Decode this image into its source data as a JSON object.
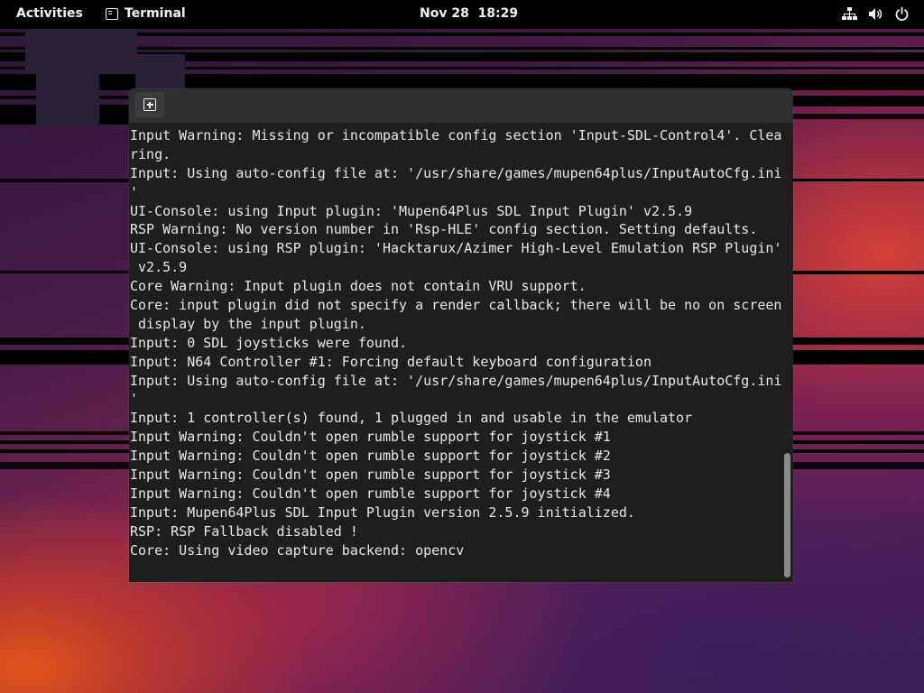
{
  "topbar": {
    "activities_label": "Activities",
    "app_name": "Terminal",
    "clock": "Nov 28  18:29",
    "tray_icons": [
      "network-wired-icon",
      "volume-icon",
      "power-icon"
    ]
  },
  "terminal": {
    "new_tab_icon": "tab-new-icon",
    "lines": [
      "Input Warning: Missing or incompatible config section 'Input-SDL-Control4'. Clea",
      "ring.",
      "Input: Using auto-config file at: '/usr/share/games/mupen64plus/InputAutoCfg.ini",
      "'",
      "UI-Console: using Input plugin: 'Mupen64Plus SDL Input Plugin' v2.5.9",
      "RSP Warning: No version number in 'Rsp-HLE' config section. Setting defaults.",
      "UI-Console: using RSP plugin: 'Hacktarux/Azimer High-Level Emulation RSP Plugin'",
      " v2.5.9",
      "Core Warning: Input plugin does not contain VRU support.",
      "Core: input plugin did not specify a render callback; there will be no on screen",
      " display by the input plugin.",
      "Input: 0 SDL joysticks were found.",
      "Input: N64 Controller #1: Forcing default keyboard configuration",
      "Input: Using auto-config file at: '/usr/share/games/mupen64plus/InputAutoCfg.ini",
      "'",
      "Input: 1 controller(s) found, 1 plugged in and usable in the emulator",
      "Input Warning: Couldn't open rumble support for joystick #1",
      "Input Warning: Couldn't open rumble support for joystick #2",
      "Input Warning: Couldn't open rumble support for joystick #3",
      "Input Warning: Couldn't open rumble support for joystick #4",
      "Input: Mupen64Plus SDL Input Plugin version 2.5.9 initialized.",
      "RSP: RSP Fallback disabled !",
      "Core: Using video capture backend: opencv"
    ]
  },
  "colors": {
    "topbar_bg": "#000000",
    "terminal_bg": "#1e1e1e",
    "terminal_fg": "#e8e8e8",
    "headerbar_bg": "#303030"
  }
}
